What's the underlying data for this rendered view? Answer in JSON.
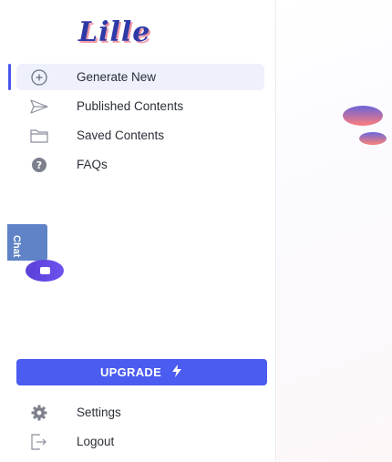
{
  "brand": {
    "logo_text": "Lille",
    "logo_color": "#2f3aa8",
    "logo_shadow_color": "#f29aa6"
  },
  "nav": {
    "items": [
      {
        "label": "Generate New",
        "icon": "plus-circle-icon",
        "active": true
      },
      {
        "label": "Published Contents",
        "icon": "send-icon",
        "active": false
      },
      {
        "label": "Saved Contents",
        "icon": "folder-icon",
        "active": false
      },
      {
        "label": "FAQs",
        "icon": "help-circle-icon",
        "active": false
      }
    ]
  },
  "chat": {
    "label": "Chat",
    "icon": "chat-bubble-icon"
  },
  "upgrade": {
    "label": "UPGRADE",
    "icon": "lightning-icon",
    "color": "#4b5cf0"
  },
  "bottom_nav": {
    "items": [
      {
        "label": "Settings",
        "icon": "gear-icon"
      },
      {
        "label": "Logout",
        "icon": "logout-icon"
      }
    ]
  },
  "colors": {
    "accent": "#4a56ee",
    "active_background": "#eef0fc"
  }
}
